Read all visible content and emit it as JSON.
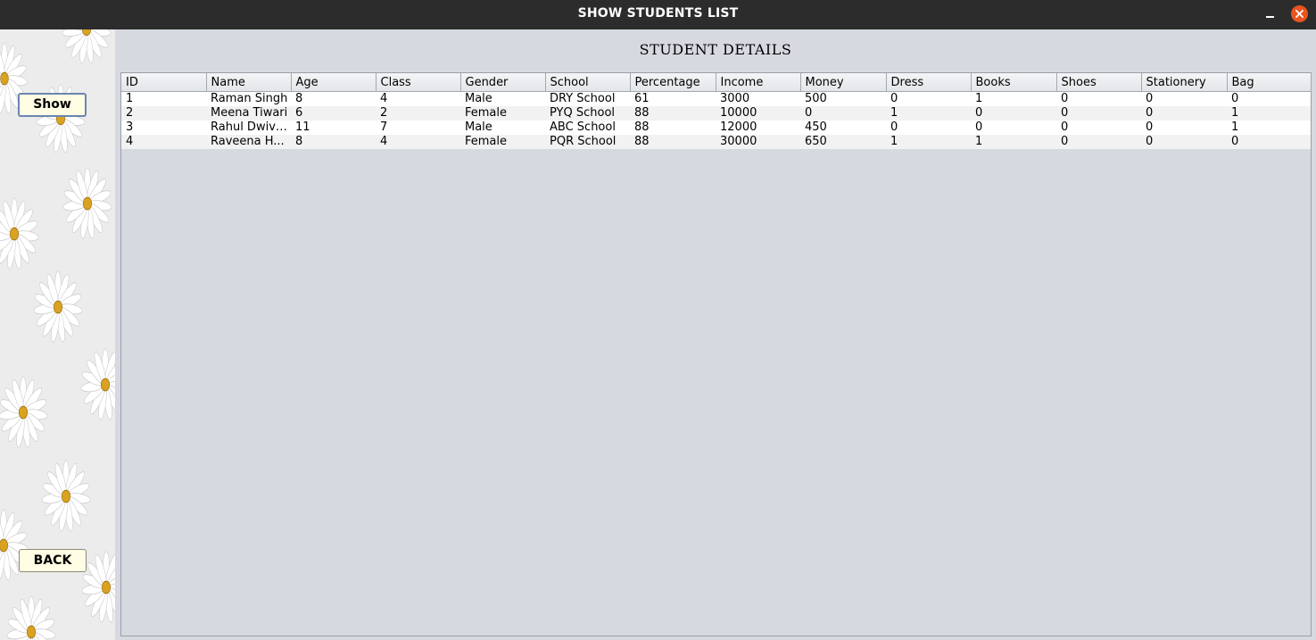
{
  "window": {
    "title": "SHOW STUDENTS LIST",
    "close_color": "#e95420"
  },
  "sidebar": {
    "show_label": "Show",
    "back_label": "BACK",
    "background_motif": "daisy-flowers"
  },
  "main": {
    "heading": "STUDENT DETAILS"
  },
  "table": {
    "columns": [
      "ID",
      "Name",
      "Age",
      "Class",
      "Gender",
      "School",
      "Percentage",
      "Income",
      "Money",
      "Dress",
      "Books",
      "Shoes",
      "Stationery",
      "Bag"
    ],
    "rows": [
      [
        "1",
        "Raman Singh",
        "8",
        "4",
        "Male",
        "DRY School",
        "61",
        "3000",
        "500",
        "0",
        "1",
        "0",
        "0",
        "0"
      ],
      [
        "2",
        "Meena Tiwari",
        "6",
        "2",
        "Female",
        "PYQ School",
        "88",
        "10000",
        "0",
        "1",
        "0",
        "0",
        "0",
        "1"
      ],
      [
        "3",
        "Rahul Dwivedi",
        "11",
        "7",
        "Male",
        "ABC School",
        "88",
        "12000",
        "450",
        "0",
        "0",
        "0",
        "0",
        "1"
      ],
      [
        "4",
        "Raveena H...",
        "8",
        "4",
        "Female",
        "PQR School",
        "88",
        "30000",
        "650",
        "1",
        "1",
        "0",
        "0",
        "0"
      ]
    ]
  }
}
